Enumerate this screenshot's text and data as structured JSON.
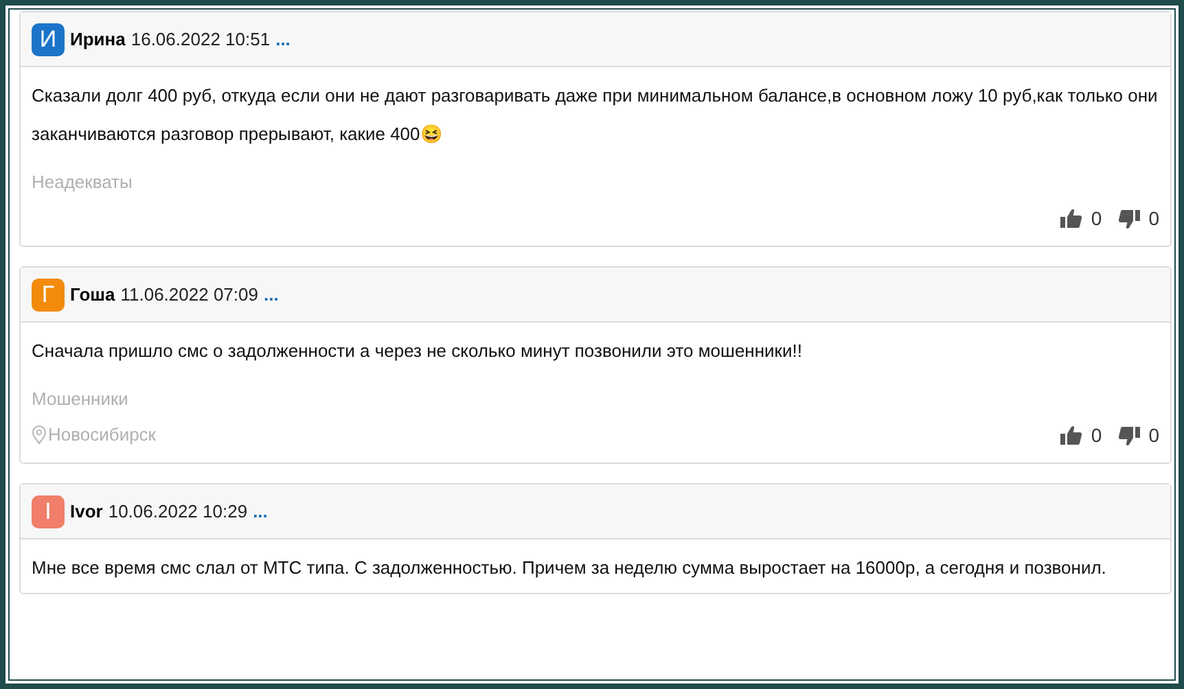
{
  "comments": [
    {
      "initial": "И",
      "color": "#1b74c9",
      "author": "Ирина",
      "date": "16.06.2022 10:51",
      "more": "...",
      "text": "Сказали долг 400 руб, откуда если они не дают разговаривать даже при минимальном балансе,в основном ложу 10 руб,как только они заканчиваются разговор прерывают, какие 400😆",
      "tag": "Неадекваты",
      "likes": "0",
      "dislikes": "0"
    },
    {
      "initial": "Г",
      "color": "#f28b0c",
      "author": "Гоша",
      "date": "11.06.2022 07:09",
      "more": "...",
      "text": "Сначала пришло смс о задолженности а через не сколько минут позвонили это мошенники!!",
      "tag": "Мошенники",
      "location": "Новосибирск",
      "likes": "0",
      "dislikes": "0"
    },
    {
      "initial": "I",
      "color": "#f07e6a",
      "author": "Ivor",
      "date": "10.06.2022 10:29",
      "more": "...",
      "text": "Мне все время смс слал от МТС типа. С задолженностью. Причем за неделю сумма выростает на 16000р, а сегодня и позвонил."
    }
  ]
}
